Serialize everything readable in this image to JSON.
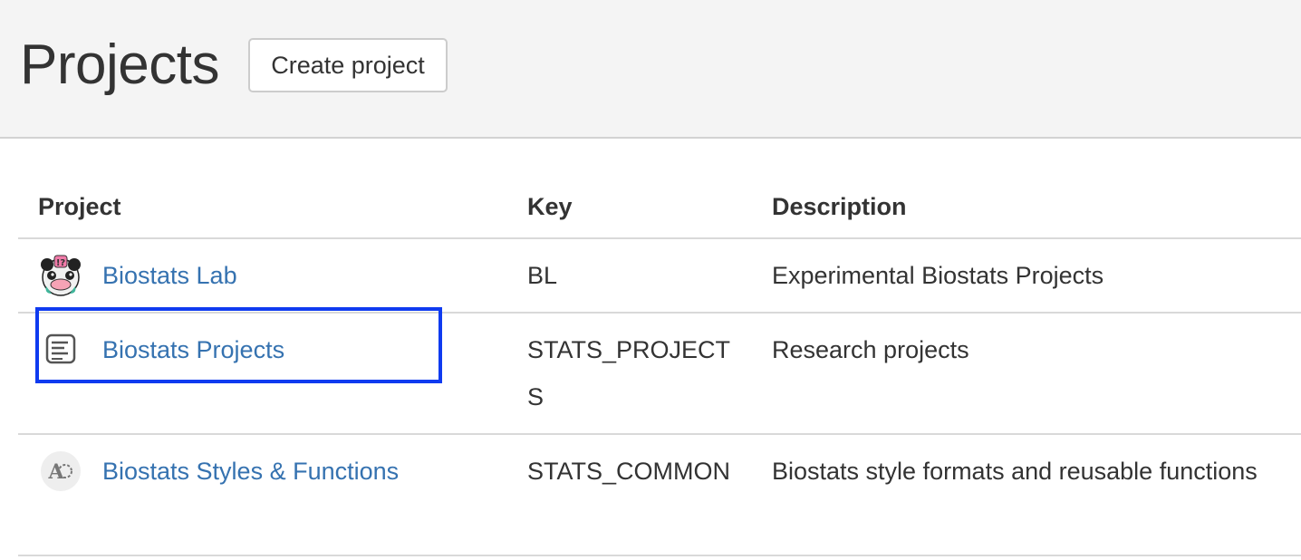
{
  "header": {
    "title": "Projects",
    "create_button_label": "Create project"
  },
  "table": {
    "columns": [
      "Project",
      "Key",
      "Description"
    ],
    "rows": [
      {
        "name": "Biostats Lab",
        "key": "BL",
        "description": "Experimental Biostats Projects",
        "avatar_icon": "cartoon-creature-avatar-icon"
      },
      {
        "name": "Biostats Projects",
        "key": "STATS_PROJECTS",
        "description": "Research projects",
        "avatar_icon": "document-lines-icon"
      },
      {
        "name": "Biostats Styles & Functions",
        "key": "STATS_COMMON",
        "description": "Biostats style formats and reusable functions",
        "avatar_icon": "letter-a-gear-icon"
      }
    ]
  },
  "colors": {
    "link": "#3572b0",
    "header_bg": "#f4f4f4",
    "selection": "#0f3bf0"
  }
}
